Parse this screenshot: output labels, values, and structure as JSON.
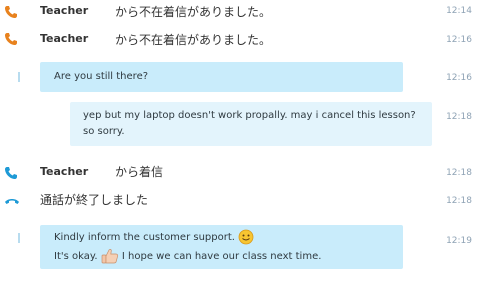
{
  "messages": [
    {
      "sender": "Teacher",
      "text": "から不在着信がありました。",
      "time": "12:14",
      "icon": "phone-missed-icon"
    },
    {
      "sender": "Teacher",
      "text": "から不在着信がありました。",
      "time": "12:16",
      "icon": "phone-missed-icon"
    },
    {
      "text": "Are you still there?",
      "time": "12:16"
    },
    {
      "text_line1": "yep but my laptop doesn't work propally. may i cancel this lesson?",
      "text_line2": "so sorry.",
      "time": "12:18"
    },
    {
      "sender": "Teacher",
      "text": "から着信",
      "time": "12:18",
      "icon": "phone-incoming-icon"
    },
    {
      "text": "通話が終了しました",
      "time": "12:18",
      "icon": "phone-hangup-icon"
    },
    {
      "text_line1": "Kindly inform the customer support.",
      "text_line2_before": "It's okay.",
      "text_line2_after": "I hope we can have our class next time.",
      "time": "12:19",
      "emoji1": "smiley-emoji",
      "emoji2": "thumbs-up-emoji"
    }
  ],
  "colors": {
    "bubble": "#c9ecfb",
    "bubble_light": "#e3f4fc",
    "phone_orange": "#e8821e",
    "phone_blue": "#1e9ad6",
    "time": "#8fa3b5"
  }
}
